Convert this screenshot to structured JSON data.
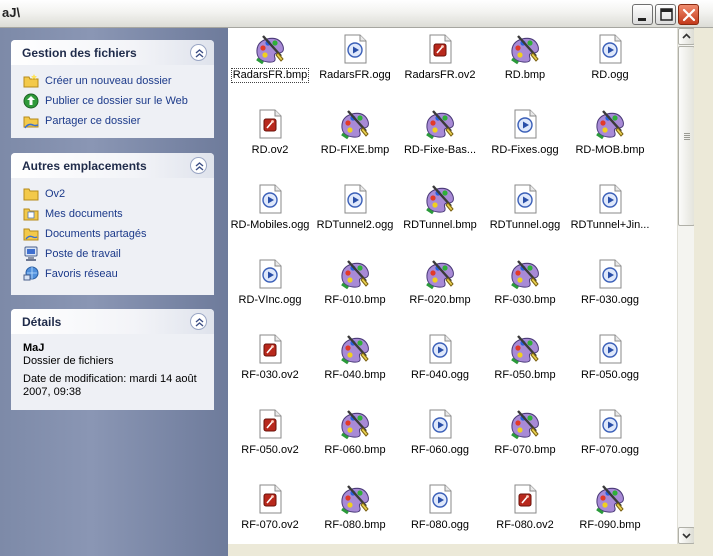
{
  "window": {
    "title": "aJ\\"
  },
  "titlebar_buttons": {
    "minimize": "minimize",
    "maximize": "maximize",
    "close": "close"
  },
  "tasks_panel": {
    "title": "Gestion des fichiers",
    "items": [
      {
        "label": "Créer un nouveau dossier",
        "icon": "new-folder-icon"
      },
      {
        "label": "Publier ce dossier sur le Web",
        "icon": "publish-web-icon"
      },
      {
        "label": "Partager ce dossier",
        "icon": "share-folder-icon"
      }
    ]
  },
  "places_panel": {
    "title": "Autres emplacements",
    "items": [
      {
        "label": "Ov2",
        "icon": "folder-icon"
      },
      {
        "label": "Mes documents",
        "icon": "my-documents-icon"
      },
      {
        "label": "Documents partagés",
        "icon": "shared-documents-icon"
      },
      {
        "label": "Poste de travail",
        "icon": "my-computer-icon"
      },
      {
        "label": "Favoris réseau",
        "icon": "network-places-icon"
      }
    ]
  },
  "details_panel": {
    "title": "Détails",
    "name": "MaJ",
    "type": "Dossier de fichiers",
    "modified_line1": "Date de modification: mardi 14 août",
    "modified_line2": "2007, 09:38"
  },
  "files": [
    {
      "name": "RadarsFR.bmp",
      "type": "bmp",
      "selected": true
    },
    {
      "name": "RadarsFR.ogg",
      "type": "ogg"
    },
    {
      "name": "RadarsFR.ov2",
      "type": "ov2"
    },
    {
      "name": "RD.bmp",
      "type": "bmp"
    },
    {
      "name": "RD.ogg",
      "type": "ogg"
    },
    {
      "name": "RD.ov2",
      "type": "ov2"
    },
    {
      "name": "RD-FIXE.bmp",
      "type": "bmp"
    },
    {
      "name": "RD-Fixe-Bas...",
      "type": "bmp"
    },
    {
      "name": "RD-Fixes.ogg",
      "type": "ogg"
    },
    {
      "name": "RD-MOB.bmp",
      "type": "bmp"
    },
    {
      "name": "RD-Mobiles.ogg",
      "type": "ogg"
    },
    {
      "name": "RDTunnel2.ogg",
      "type": "ogg"
    },
    {
      "name": "RDTunnel.bmp",
      "type": "bmp"
    },
    {
      "name": "RDTunnel.ogg",
      "type": "ogg"
    },
    {
      "name": "RDTunnel+Jin...",
      "type": "ogg"
    },
    {
      "name": "RD-VInc.ogg",
      "type": "ogg"
    },
    {
      "name": "RF-010.bmp",
      "type": "bmp"
    },
    {
      "name": "RF-020.bmp",
      "type": "bmp"
    },
    {
      "name": "RF-030.bmp",
      "type": "bmp"
    },
    {
      "name": "RF-030.ogg",
      "type": "ogg"
    },
    {
      "name": "RF-030.ov2",
      "type": "ov2"
    },
    {
      "name": "RF-040.bmp",
      "type": "bmp"
    },
    {
      "name": "RF-040.ogg",
      "type": "ogg"
    },
    {
      "name": "RF-050.bmp",
      "type": "bmp"
    },
    {
      "name": "RF-050.ogg",
      "type": "ogg"
    },
    {
      "name": "RF-050.ov2",
      "type": "ov2"
    },
    {
      "name": "RF-060.bmp",
      "type": "bmp"
    },
    {
      "name": "RF-060.ogg",
      "type": "ogg"
    },
    {
      "name": "RF-070.bmp",
      "type": "bmp"
    },
    {
      "name": "RF-070.ogg",
      "type": "ogg"
    },
    {
      "name": "RF-070.ov2",
      "type": "ov2"
    },
    {
      "name": "RF-080.bmp",
      "type": "bmp"
    },
    {
      "name": "RF-080.ogg",
      "type": "ogg"
    },
    {
      "name": "RF-080.ov2",
      "type": "ov2"
    },
    {
      "name": "RF-090.bmp",
      "type": "bmp"
    }
  ],
  "icon_names": {
    "bmp": "paint-bitmap-icon",
    "ogg": "media-audio-icon",
    "ov2": "ov2-document-icon"
  }
}
